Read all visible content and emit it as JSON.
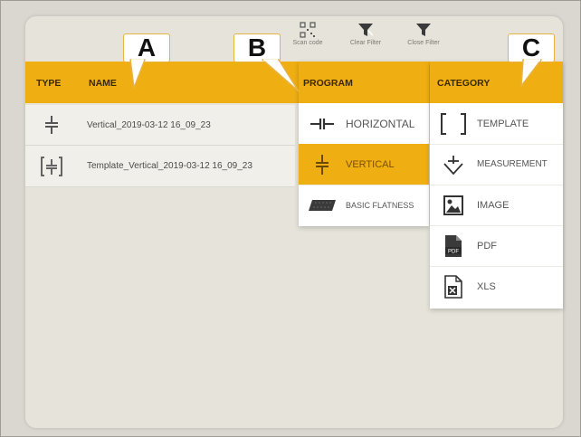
{
  "toolbar": {
    "scan_code": "Scan code",
    "clear_filter": "Clear Filter",
    "close_filter": "Close Filter"
  },
  "callouts": [
    "A",
    "B",
    "C"
  ],
  "headers": {
    "type": "TYPE",
    "name": "NAME",
    "program": "PROGRAM",
    "category": "CATEGORY"
  },
  "rows": [
    {
      "type_icon": "vertical-program-icon",
      "name": "Vertical_2019-03-12 16_09_23"
    },
    {
      "type_icon": "template-vertical-icon",
      "name": "Template_Vertical_2019-03-12 16_09_23"
    }
  ],
  "program_menu": [
    {
      "label": "HORIZONTAL",
      "icon": "horizontal-icon",
      "selected": false
    },
    {
      "label": "VERTICAL",
      "icon": "vertical-icon",
      "selected": true
    },
    {
      "label": "BASIC FLATNESS",
      "icon": "basic-flatness-icon",
      "selected": false
    }
  ],
  "category_menu": [
    {
      "label": "TEMPLATE",
      "icon": "template-bracket-icon"
    },
    {
      "label": "MEASUREMENT",
      "icon": "measurement-icon"
    },
    {
      "label": "IMAGE",
      "icon": "image-icon"
    },
    {
      "label": "PDF",
      "icon": "pdf-file-icon"
    },
    {
      "label": "XLS",
      "icon": "xls-file-icon"
    }
  ],
  "colors": {
    "accent": "#efae12",
    "panel": "#e6e4da",
    "row": "#f0efe9"
  }
}
